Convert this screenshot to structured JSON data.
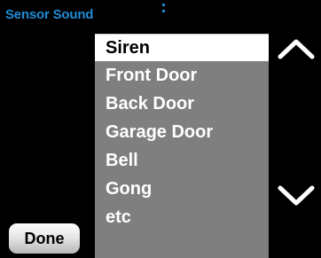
{
  "header": {
    "title": "Sensor Sound"
  },
  "sound_list": {
    "selected_index": 0,
    "items": [
      {
        "label": "Siren"
      },
      {
        "label": "Front Door"
      },
      {
        "label": "Back Door"
      },
      {
        "label": "Garage Door"
      },
      {
        "label": "Bell"
      },
      {
        "label": "Gong"
      },
      {
        "label": "etc"
      }
    ]
  },
  "controls": {
    "done_label": "Done",
    "scroll_up_icon": "chevron-up-icon",
    "scroll_down_icon": "chevron-down-icon"
  },
  "colors": {
    "background": "#000000",
    "title": "#1e8cd6",
    "list_background": "#7f7f7f",
    "selected_background": "#ffffff",
    "item_text": "#ffffff",
    "selected_text": "#000000",
    "button_face": "#e6e6e6"
  }
}
